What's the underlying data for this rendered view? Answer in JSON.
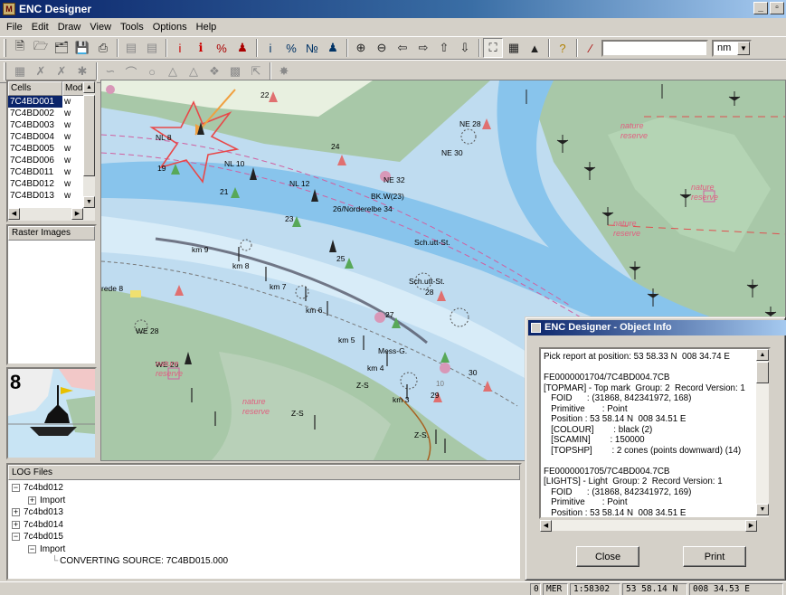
{
  "window": {
    "title": "ENC Designer",
    "icon": "M"
  },
  "menu": [
    "File",
    "Edit",
    "Draw",
    "View",
    "Tools",
    "Options",
    "Help"
  ],
  "toolbar": {
    "unit": "nm",
    "coord_value": ""
  },
  "cells": {
    "headers": [
      "Cells",
      "Mode"
    ],
    "rows": [
      {
        "name": "7C4BD001",
        "mode": "w"
      },
      {
        "name": "7C4BD002",
        "mode": "w"
      },
      {
        "name": "7C4BD003",
        "mode": "w"
      },
      {
        "name": "7C4BD004",
        "mode": "w"
      },
      {
        "name": "7C4BD005",
        "mode": "w"
      },
      {
        "name": "7C4BD006",
        "mode": "w"
      },
      {
        "name": "7C4BD011",
        "mode": "w"
      },
      {
        "name": "7C4BD012",
        "mode": "w"
      },
      {
        "name": "7C4BD013",
        "mode": "w"
      }
    ]
  },
  "raster": {
    "header": "Raster Images"
  },
  "map": {
    "labels": [
      "22",
      "NE 28",
      "NL 8",
      "NE 30",
      "24",
      "NL 10",
      "19",
      "NE 32",
      "NL 12",
      "BK.W(23)",
      "21",
      "26/Norderelbe 34",
      "23",
      "Sch.utt-St.",
      "km 9",
      "25",
      "km 8",
      "Sch.utt-St.",
      "28",
      "km 7",
      "km 6",
      "27",
      "WE 28",
      "km 5",
      "Mess-G.",
      "WE 26",
      "km 4",
      "30",
      "Z-S",
      "km 3",
      "29",
      "Z-S",
      "Z-S.",
      "rede 8",
      "nature",
      "reserve",
      "nature",
      "reserve",
      "nature",
      "reserve",
      "nature",
      "reserve",
      "nature",
      "reserve",
      "10",
      "8"
    ],
    "colors": {
      "sea": "#bfdcf0",
      "shallow": "#88c4ec",
      "land": "#a8c8a8",
      "danger": "#e83030",
      "arrow": "#f0a040"
    }
  },
  "log": {
    "header": "LOG Files",
    "items": [
      {
        "label": "7c4bd012",
        "box": "−"
      },
      {
        "label": "Import",
        "box": "+"
      },
      {
        "label": "7c4bd013",
        "box": "+"
      },
      {
        "label": "7c4bd014",
        "box": "+"
      },
      {
        "label": "7c4bd015",
        "box": "−"
      },
      {
        "label": "Import",
        "box": "−"
      },
      {
        "label": "CONVERTING SOURCE: 7C4BD015.000",
        "box": ""
      }
    ]
  },
  "dialog": {
    "title": "ENC Designer - Object Info",
    "lines": [
      "Pick report at position: 53 58.33 N  008 34.74 E",
      "",
      "FE0000001704/7C4BD004.7CB",
      "[TOPMAR] - Top mark  Group: 2  Record Version: 1",
      "   FOID      : (31868, 842341972, 168)",
      "   Primitive       : Point",
      "   Position : 53 58.14 N  008 34.51 E",
      "   [COLOUR]        : black (2)",
      "   [SCAMIN]        : 150000",
      "   [TOPSHP]        : 2 cones (points downward) (14)",
      "",
      "FE0000001705/7C4BD004.7CB",
      "[LIGHTS] - Light  Group: 2  Record Version: 1",
      "   FOID      : (31868, 842341972, 169)",
      "   Primitive       : Point",
      "   Position : 53 58.14 N  008 34.51 E"
    ],
    "close_label": "Close",
    "print_label": "Print"
  },
  "status": {
    "cell0": "0",
    "datum": "MER",
    "scale": "1:58302",
    "lat": "53 58.14 N",
    "lon": "008 34.53 E"
  }
}
